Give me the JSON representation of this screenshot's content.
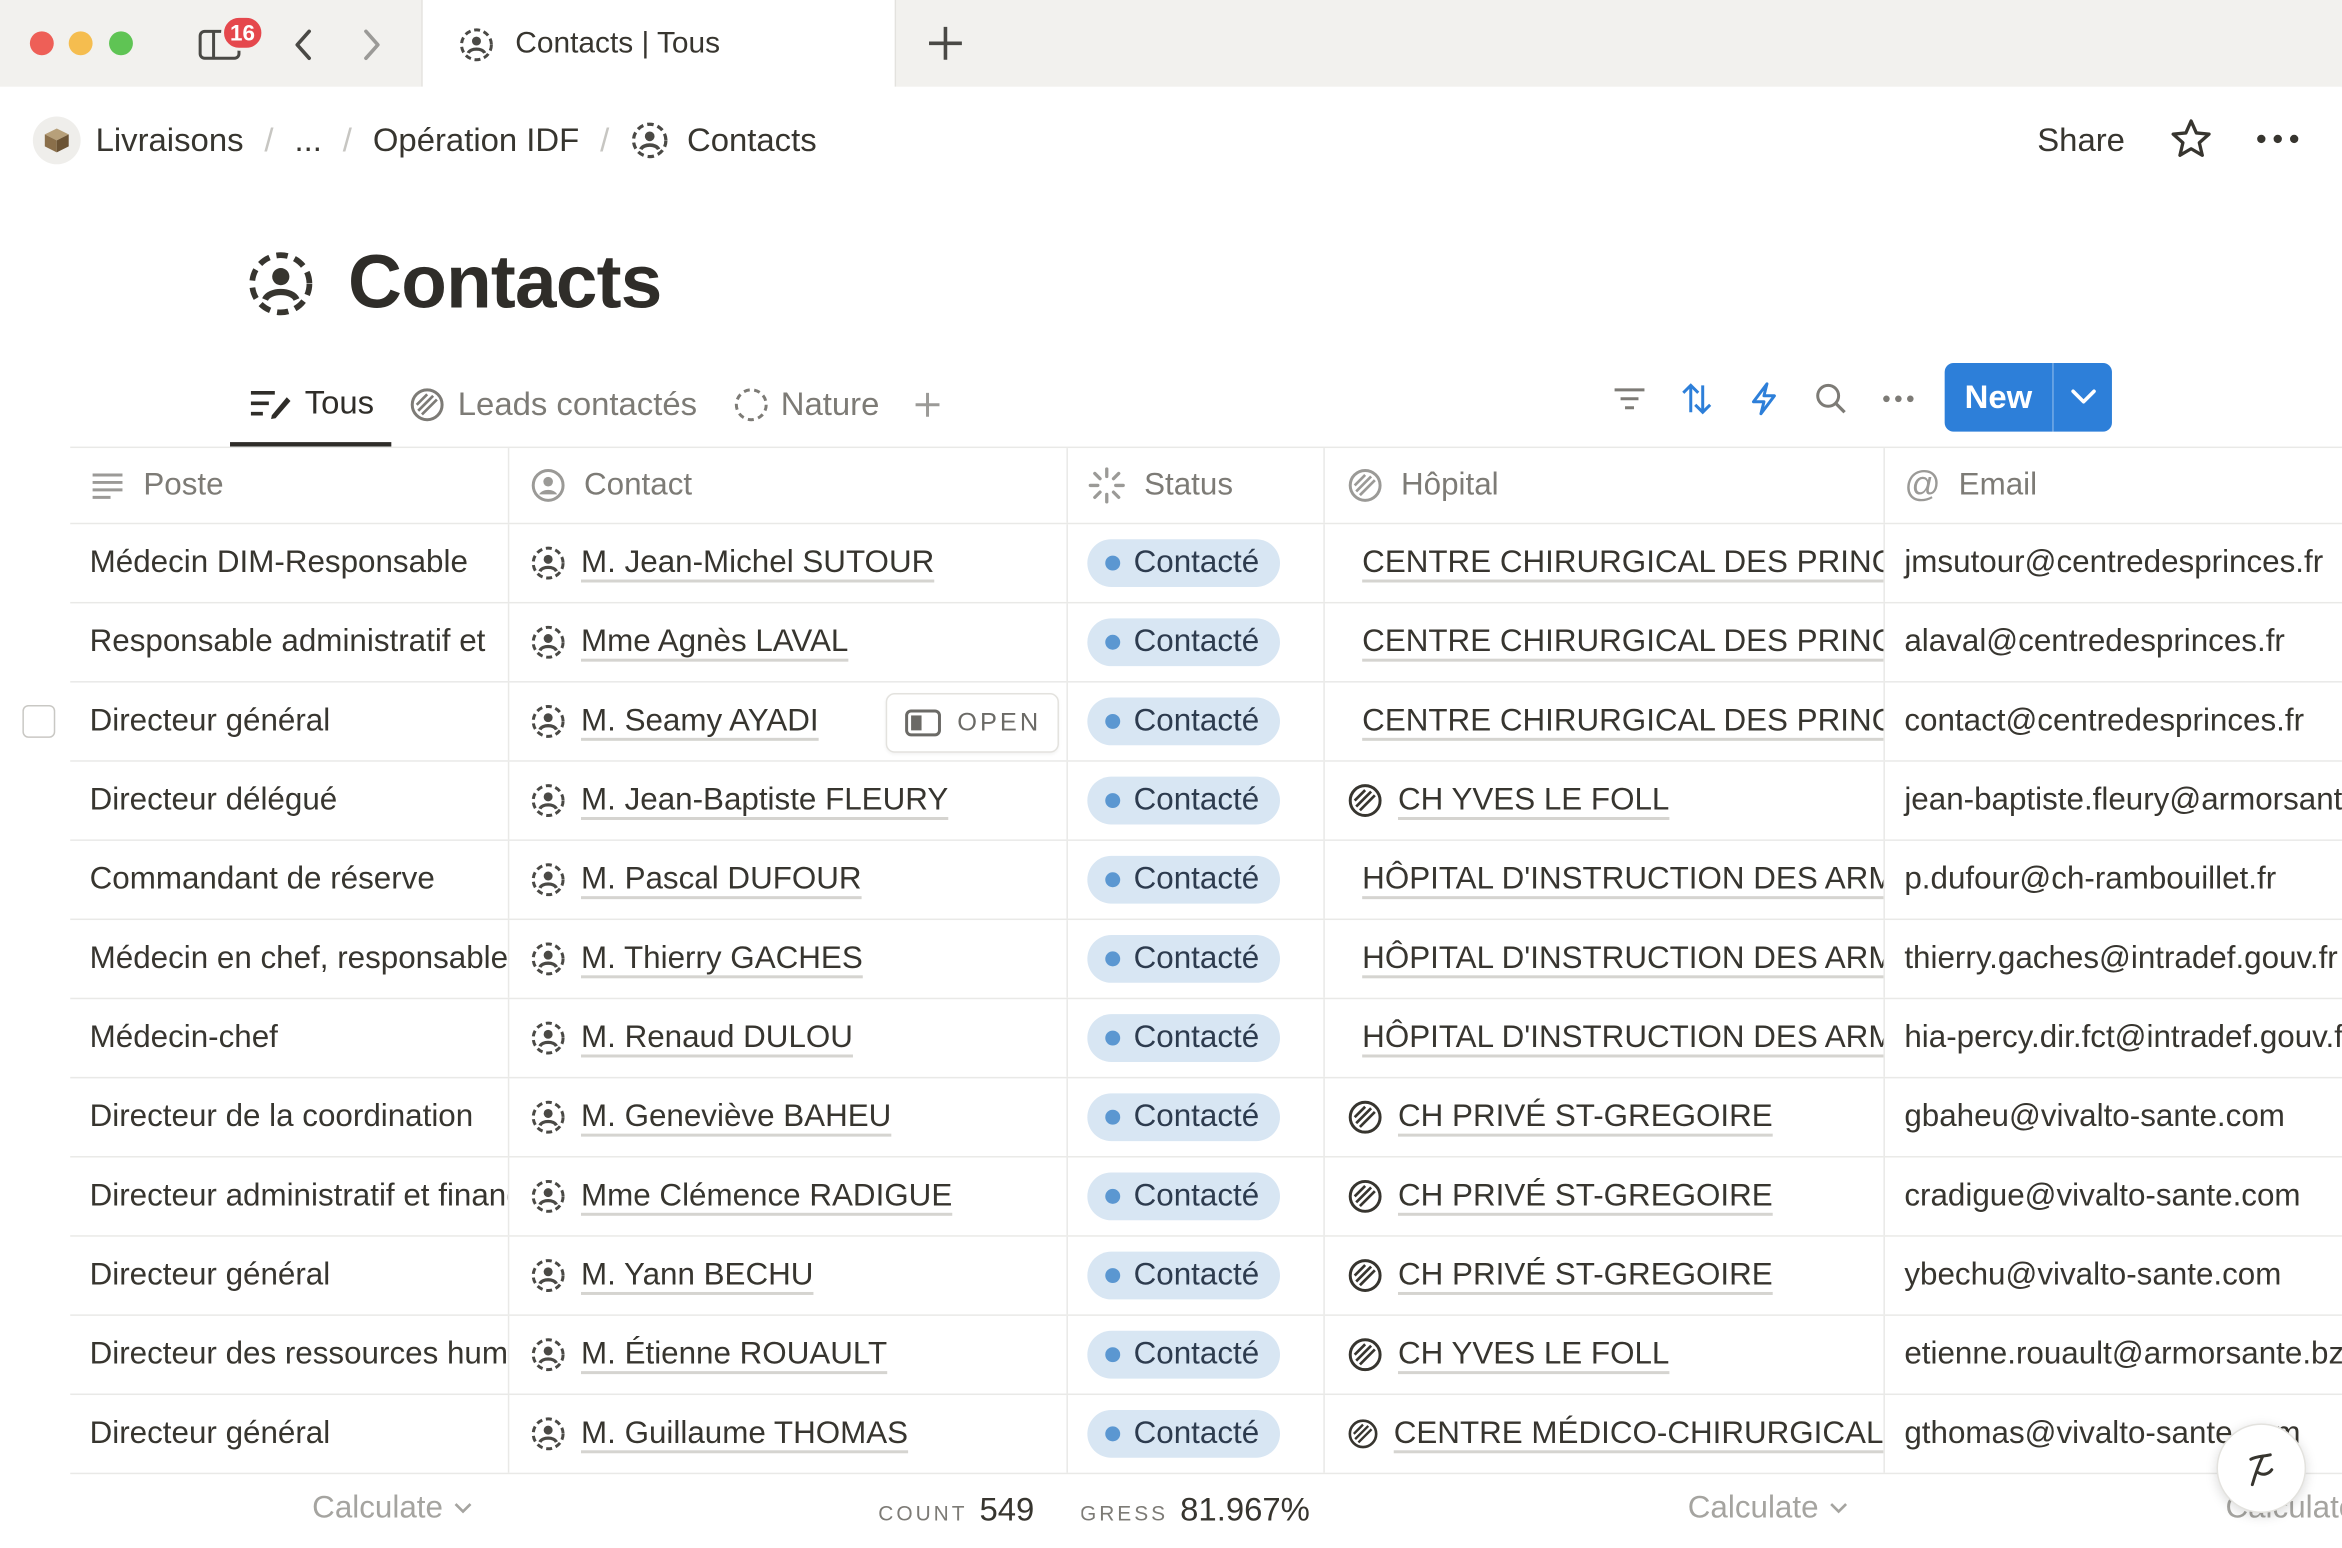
{
  "window": {
    "tab_count_badge": "16",
    "active_tab_title": "Contacts | Tous"
  },
  "breadcrumb": {
    "items": [
      "Livraisons",
      "...",
      "Opération IDF",
      "Contacts"
    ]
  },
  "topbar": {
    "share_label": "Share"
  },
  "page": {
    "title": "Contacts"
  },
  "views": {
    "items": [
      {
        "label": "Tous",
        "icon": "table-edit-icon",
        "active": true
      },
      {
        "label": "Leads contactés",
        "icon": "hatched-circle-icon",
        "active": false
      },
      {
        "label": "Nature",
        "icon": "dashed-circle-icon",
        "active": false
      }
    ]
  },
  "toolbar": {
    "new_label": "New"
  },
  "table": {
    "columns": [
      {
        "label": "Poste",
        "icon": "text-lines-icon"
      },
      {
        "label": "Contact",
        "icon": "person-circle-icon"
      },
      {
        "label": "Status",
        "icon": "status-spinner-icon"
      },
      {
        "label": "Hôpital",
        "icon": "relation-icon"
      },
      {
        "label": "Email",
        "icon": "at-icon"
      }
    ],
    "open_label": "OPEN",
    "rows": [
      {
        "poste": "Médecin DIM-Responsable",
        "contact": "M. Jean-Michel SUTOUR",
        "status": "Contacté",
        "hopital": "CENTRE CHIRURGICAL DES PRINCES",
        "email": "jmsutour@centredesprinces.fr"
      },
      {
        "poste": "Responsable administratif et",
        "contact": "Mme Agnès LAVAL",
        "status": "Contacté",
        "hopital": "CENTRE CHIRURGICAL DES PRINCES",
        "email": "alaval@centredesprinces.fr"
      },
      {
        "poste": "Directeur général",
        "contact": "M. Seamy AYADI",
        "status": "Contacté",
        "hopital": "CENTRE CHIRURGICAL DES PRINCES",
        "email": "contact@centredesprinces.fr"
      },
      {
        "poste": "Directeur délégué",
        "contact": "M. Jean-Baptiste FLEURY",
        "status": "Contacté",
        "hopital": "CH YVES LE FOLL",
        "email": "jean-baptiste.fleury@armorsante.bzh"
      },
      {
        "poste": "Commandant de réserve",
        "contact": "M. Pascal DUFOUR",
        "status": "Contacté",
        "hopital": "HÔPITAL D'INSTRUCTION DES ARMÉES",
        "email": "p.dufour@ch-rambouillet.fr"
      },
      {
        "poste": "Médecin en chef, responsable",
        "contact": "M. Thierry GACHES",
        "status": "Contacté",
        "hopital": "HÔPITAL D'INSTRUCTION DES ARMÉES",
        "email": "thierry.gaches@intradef.gouv.fr"
      },
      {
        "poste": "Médecin-chef",
        "contact": "M. Renaud DULOU",
        "status": "Contacté",
        "hopital": "HÔPITAL D'INSTRUCTION DES ARMÉES",
        "email": "hia-percy.dir.fct@intradef.gouv.fr"
      },
      {
        "poste": "Directeur de la coordination",
        "contact": "M. Geneviève BAHEU",
        "status": "Contacté",
        "hopital": "CH PRIVÉ ST-GREGOIRE",
        "email": "gbaheu@vivalto-sante.com"
      },
      {
        "poste": "Directeur administratif et financier",
        "contact": "Mme Clémence RADIGUE",
        "status": "Contacté",
        "hopital": "CH PRIVÉ ST-GREGOIRE",
        "email": "cradigue@vivalto-sante.com"
      },
      {
        "poste": "Directeur général",
        "contact": "M. Yann BECHU",
        "status": "Contacté",
        "hopital": "CH PRIVÉ ST-GREGOIRE",
        "email": "ybechu@vivalto-sante.com"
      },
      {
        "poste": "Directeur des ressources humaines",
        "contact": "M. Étienne ROUAULT",
        "status": "Contacté",
        "hopital": "CH YVES LE FOLL",
        "email": "etienne.rouault@armorsante.bzh"
      },
      {
        "poste": "Directeur général",
        "contact": "M. Guillaume THOMAS",
        "status": "Contacté",
        "hopital": "CENTRE MÉDICO-CHIRURGICAL",
        "email": "gthomas@vivalto-sante.com"
      }
    ]
  },
  "footer": {
    "calculate_label": "Calculate",
    "count_label": "COUNT",
    "count_value": "549",
    "progress_label": "PROGRESS",
    "progress_value": "81.967%"
  },
  "colors": {
    "accent": "#2d7fd9",
    "status_pill_bg": "#d8e6f3",
    "status_dot": "#5b97d1",
    "badge": "#e5484d"
  }
}
